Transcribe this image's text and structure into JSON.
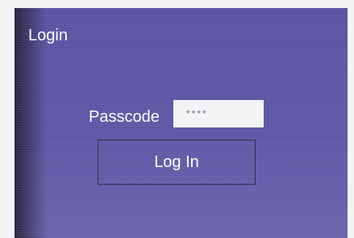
{
  "screen": {
    "title": "Login"
  },
  "form": {
    "passcode_label": "Passcode",
    "passcode_value": "****",
    "login_button_label": "Log In"
  },
  "colors": {
    "screen_background": "#5f58a6",
    "text": "#ffffff",
    "input_background": "#f3f3f6"
  }
}
